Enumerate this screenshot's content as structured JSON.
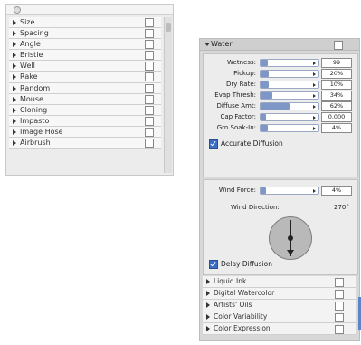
{
  "colors": {
    "accent": "#7f97c7",
    "checkbox_blue": "#3c6bc6",
    "panel_bg": "#ececec"
  },
  "left_panel": {
    "items": [
      {
        "label": "Size"
      },
      {
        "label": "Spacing"
      },
      {
        "label": "Angle"
      },
      {
        "label": "Bristle"
      },
      {
        "label": "Well"
      },
      {
        "label": "Rake"
      },
      {
        "label": "Random"
      },
      {
        "label": "Mouse"
      },
      {
        "label": "Cloning"
      },
      {
        "label": "Impasto"
      },
      {
        "label": "Image Hose"
      },
      {
        "label": "Airbrush"
      }
    ]
  },
  "water_panel": {
    "title": "Water",
    "params": [
      {
        "label": "Wetness:",
        "slider_text": "",
        "fill": 0.12,
        "value": "99"
      },
      {
        "label": "Pickup:",
        "slider_text": "",
        "fill": 0.14,
        "value": "20%"
      },
      {
        "label": "Dry Rate:",
        "slider_text": "",
        "fill": 0.14,
        "value": "10%"
      },
      {
        "label": "Evap Thresh:",
        "slider_text": "",
        "fill": 0.2,
        "value": "34%"
      },
      {
        "label": "Diffuse Amt:",
        "slider_text": "",
        "fill": 0.5,
        "value": "62%"
      },
      {
        "label": "Cap Factor:",
        "slider_text": "",
        "fill": 0.1,
        "value": "0.000"
      },
      {
        "label": "Grn Soak-In:",
        "slider_text": "",
        "fill": 0.12,
        "value": "4%"
      }
    ],
    "accurate_diffusion": "Accurate Diffusion",
    "wind": {
      "force_label": "Wind Force:",
      "force_value": "4%",
      "direction_label": "Wind Direction:",
      "direction_value": "270°"
    },
    "delay_diffusion": "Delay Diffusion"
  },
  "bottom_list": {
    "items": [
      {
        "label": "Liquid Ink"
      },
      {
        "label": "Digital Watercolor"
      },
      {
        "label": "Artists' Oils"
      },
      {
        "label": "Color Variability"
      },
      {
        "label": "Color Expression"
      }
    ]
  }
}
